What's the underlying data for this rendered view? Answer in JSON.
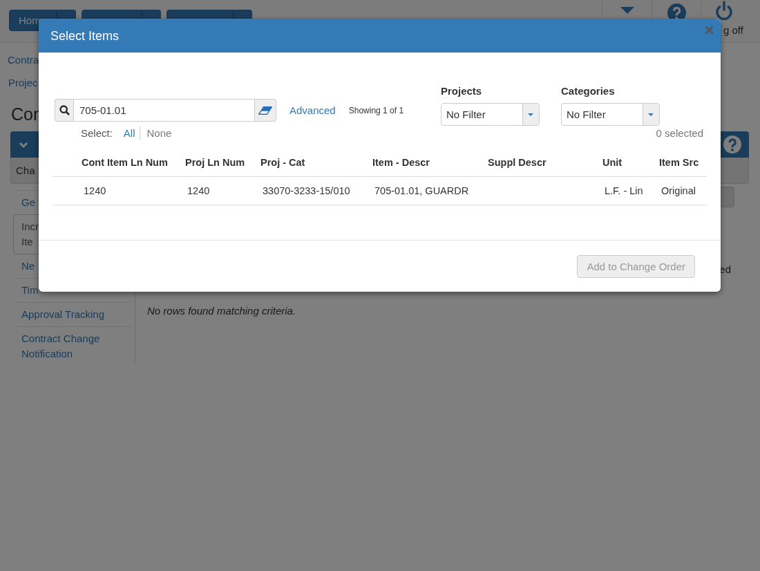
{
  "nav_buttons": [
    {
      "label": "Hom",
      "split": true
    },
    {
      "split": true
    },
    {
      "split": true
    }
  ],
  "top_right": [
    {
      "kind": "caret"
    },
    {
      "kind": "help"
    },
    {
      "kind": "power",
      "label": "g off"
    }
  ],
  "breadcrumbs": [
    "Contra",
    "Projec"
  ],
  "page_title": "Con",
  "section_bar": {
    "expanded": true
  },
  "sub_header": {
    "label": "Cha"
  },
  "sidebar": {
    "items": [
      {
        "lines": [
          "Ge"
        ],
        "selected": false
      },
      {
        "lines": [
          "Incr",
          "Ite"
        ],
        "selected": true
      },
      {
        "lines": [
          "Ne"
        ],
        "selected": false
      },
      {
        "lines": [
          "Tim"
        ],
        "selected": false
      },
      {
        "lines": [
          "Approval Tracking"
        ],
        "selected": false
      },
      {
        "lines": [
          "Contract Change",
          "Notification"
        ],
        "selected": false
      }
    ]
  },
  "main": {
    "right_text": "ed",
    "empty_message": "No rows found matching criteria."
  },
  "modal": {
    "title": "Select Items",
    "search": {
      "value": "705-01.01"
    },
    "advanced_link": "Advanced",
    "result_count": "Showing 1 of 1",
    "select": {
      "label": "Select:",
      "links": [
        {
          "label": "All",
          "disabled": false
        },
        {
          "label": "None",
          "disabled": true
        }
      ]
    },
    "filters": [
      {
        "label": "Projects",
        "value": "No Filter"
      },
      {
        "label": "Categories",
        "value": "No Filter"
      }
    ],
    "selected_count": "0 selected",
    "table": {
      "columns": [
        "Cont Item Ln Num",
        "Proj Ln Num",
        "Proj - Cat",
        "Item - Descr",
        "Suppl Descr",
        "Unit",
        "Item Src"
      ],
      "rows": [
        {
          "selected": false,
          "cells": [
            "1240",
            "1240",
            "33070-3233-15/010",
            "705-01.01, GUARDR",
            null,
            "L.F. - Lin",
            "Original"
          ]
        }
      ]
    },
    "footer_button": {
      "label": "Add to Change Order",
      "disabled": true
    }
  }
}
